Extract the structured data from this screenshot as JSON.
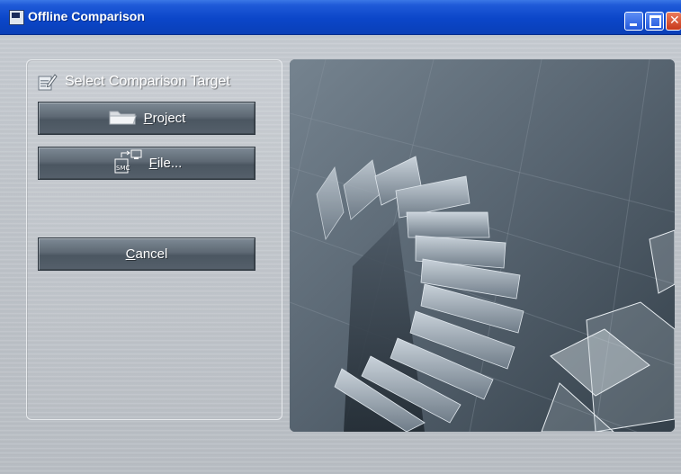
{
  "window": {
    "title": "Offline Comparison",
    "icon": "app-window-icon",
    "controls": [
      "minimize-icon",
      "maximize-icon",
      "close-icon"
    ]
  },
  "panel": {
    "header_icon": "edit-list-icon",
    "header": "Select Comparison Target"
  },
  "buttons": {
    "project": {
      "access_key": "P",
      "rest": "roject",
      "icon": "folder-icon"
    },
    "file": {
      "access_key": "F",
      "rest": "ile...",
      "icon": "smc-file-transfer-icon"
    },
    "cancel": {
      "access_key": "C",
      "rest": "ancel"
    }
  },
  "colors": {
    "titlebar": "#0b46c9",
    "button": "#5d6873",
    "background": "#bfc4ca"
  },
  "image": {
    "description_icon": "spiral-staircase-illustration"
  }
}
